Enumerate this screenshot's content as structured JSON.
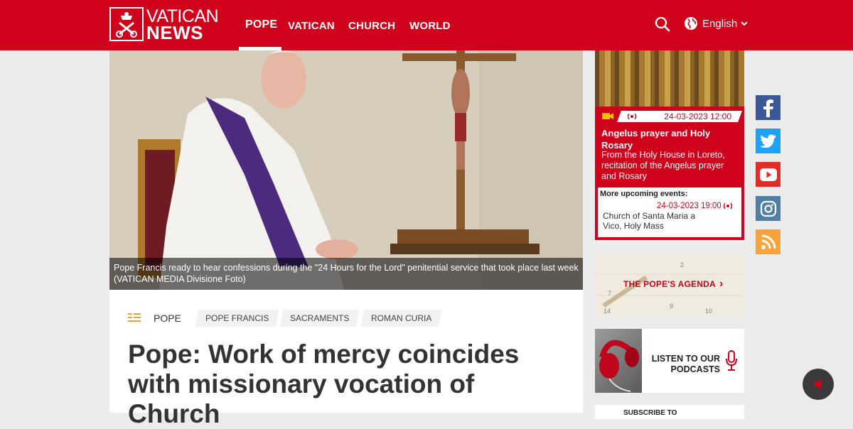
{
  "header": {
    "logo_line1": "VATICAN",
    "logo_line2": "NEWS",
    "nav": [
      "POPE",
      "VATICAN",
      "CHURCH",
      "WORLD"
    ],
    "active_nav": "POPE",
    "language": "English",
    "brand_color": "#d0021b"
  },
  "hero": {
    "caption": "Pope Francis ready to hear confessions during the \"24 Hours for the Lord\" penitential service that took place last week  (VATICAN MEDIA Divisione Foto)"
  },
  "article": {
    "section": "POPE",
    "tags": [
      "POPE FRANCIS",
      "SACRAMENTS",
      "ROMAN CURIA"
    ],
    "headline": "Pope: Work of mercy coincides with missionary vocation of Church"
  },
  "live_event": {
    "datetime": "24-03-2023 12:00",
    "title": "Angelus prayer and Holy Rosary",
    "description": "From the Holy House in Loreto, recitation of the Angelus prayer and Rosary",
    "more_label": "More upcoming events:",
    "more_datetime": "24-03-2023 19:00",
    "more_description": "Church of Santa Maria a Vico, Holy Mass"
  },
  "sidebar": {
    "agenda_label": "THE POPE'S AGENDA",
    "podcast_label": "LISTEN TO OUR PODCASTS",
    "subscribe_label": "SUBSCRIBE TO"
  },
  "social": [
    "facebook-icon",
    "twitter-icon",
    "youtube-icon",
    "instagram-icon",
    "rss-icon"
  ]
}
